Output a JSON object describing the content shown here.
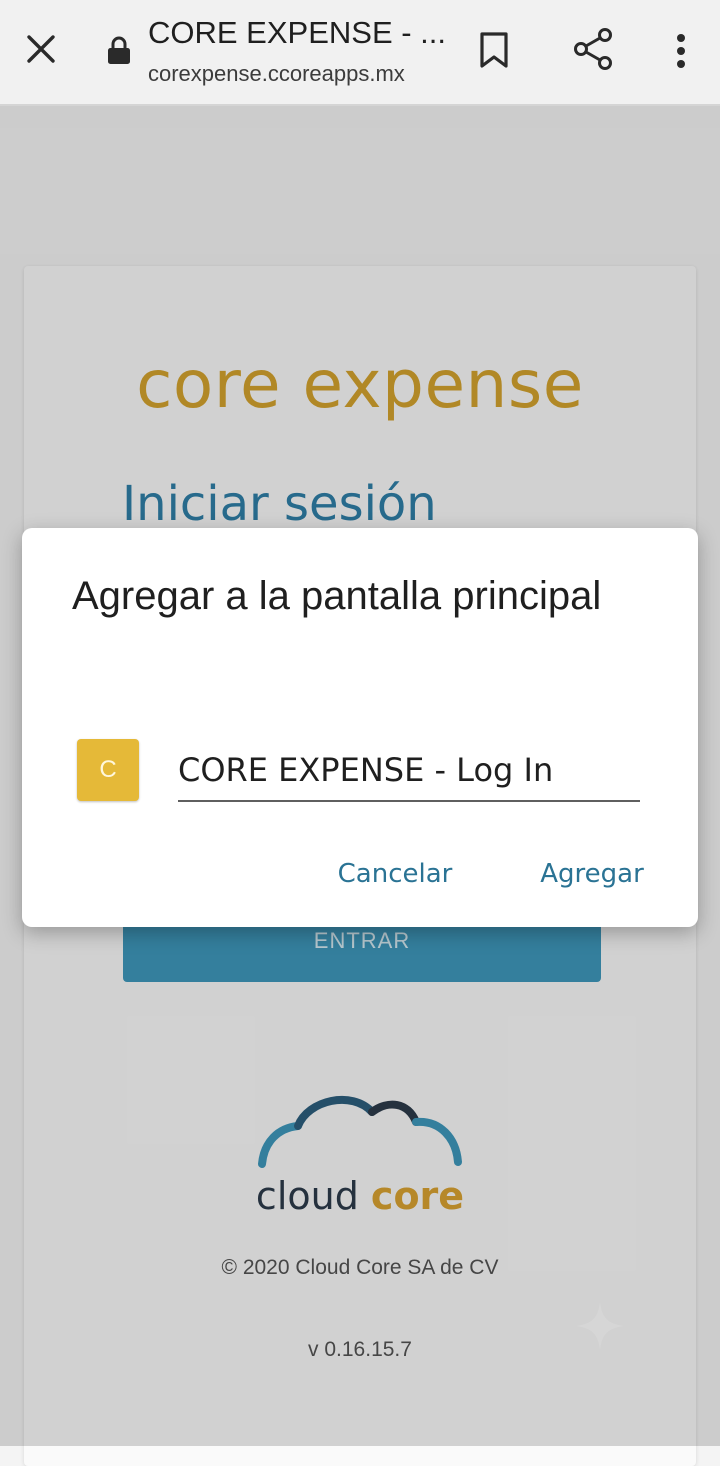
{
  "browser": {
    "tab_title": "CORE EXPENSE - ...",
    "url": "corexpense.ccoreapps.mx"
  },
  "page": {
    "brand": "core expense",
    "login_heading": "Iniciar sesión",
    "enter_button": "ENTRAR",
    "logo_word_1": "cloud",
    "logo_word_2": "core",
    "copyright": "© 2020 Cloud Core SA de CV",
    "version": "v 0.16.15.7"
  },
  "dialog": {
    "title": "Agregar a la pantalla principal",
    "app_icon_letter": "C",
    "app_name_value": "CORE EXPENSE - Log In",
    "cancel_label": "Cancelar",
    "add_label": "Agregar"
  },
  "icons": {
    "close": "close-icon",
    "lock": "lock-icon",
    "bookmark": "bookmark-icon",
    "share": "share-icon",
    "menu": "more-vert-icon"
  },
  "colors": {
    "brand_gold": "#d3a22e",
    "heading_blue": "#2f7fa7",
    "button_blue": "#3f98bb",
    "dialog_action": "#2a7394",
    "app_icon_bg": "#e5b938"
  }
}
